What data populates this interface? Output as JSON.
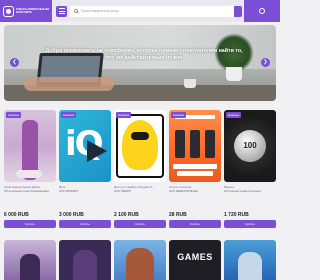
{
  "header": {
    "logo_text": "ТОВАРЫ ИЗВЕСТНЫЕ ВО ВСЕМ МИРЕ",
    "search_placeholder": "Поиск товаров или услуг"
  },
  "banner": {
    "text": "Добро пожаловать на платформу, которая поможет покупателям найти то, что им действительно нужно"
  },
  "colors": {
    "accent": "#7a4fd6"
  },
  "products": [
    {
      "badge": "Новинка",
      "title": "Трикотажные брюки Джинс",
      "seller": "ИП Антипенков Алекс Владимирович",
      "price": "6 000 RUB",
      "button": "Купить"
    },
    {
      "badge": "Новинка",
      "title": "Фото",
      "seller": "ООО ЗИМОБУР",
      "price": "3 000 RUB",
      "button": "Купить"
    },
    {
      "badge": "Новинка",
      "title": "Доступ к сервису Telegram-б...",
      "seller": "ООО ГЕМКИТ",
      "price": "2 100 RUB",
      "button": "Купить"
    },
    {
      "badge": "Новинка",
      "title": "Услуги спонсора",
      "seller": "ООО МЕДИАПРОДАКШ",
      "price": "28 RUB",
      "button": "Купить"
    },
    {
      "badge": "Новинка",
      "title": "Монета",
      "seller": "ИП Сидоров Семён Сергеевич",
      "price": "1 720 RUB",
      "button": "Купить",
      "coin_value": "100"
    }
  ],
  "bottom_tiles": [
    {
      "label": ""
    },
    {
      "label": ""
    },
    {
      "label": ""
    },
    {
      "label": "GAMES"
    },
    {
      "label": ""
    }
  ]
}
